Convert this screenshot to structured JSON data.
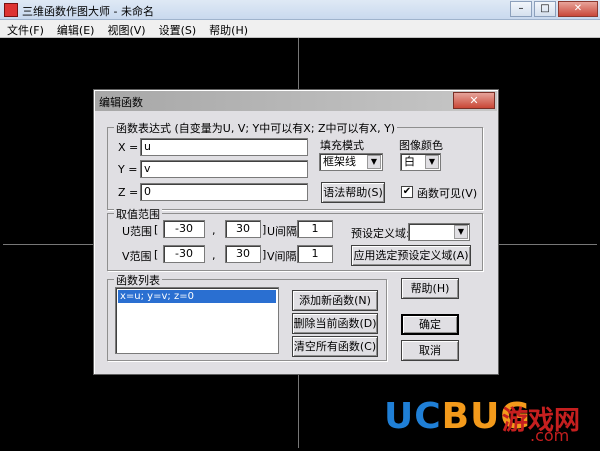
{
  "window": {
    "title": "三维函数作图大师 - 未命名",
    "min": "–",
    "max": "□",
    "close": "✕"
  },
  "menu": [
    "文件(F)",
    "编辑(E)",
    "视图(V)",
    "设置(S)",
    "帮助(H)"
  ],
  "dialog": {
    "title": "编辑函数",
    "close": "✕",
    "expr_group": {
      "title": "函数表达式 (自变量为U, V; Y中可以有X; Z中可以有X, Y)",
      "x_label": "X =",
      "x_value": "u",
      "y_label": "Y =",
      "y_value": "v",
      "z_label": "Z =",
      "z_value": "0",
      "fill_label": "填充模式",
      "fill_value": "框架线",
      "color_label": "图像颜色",
      "color_value": "白",
      "syntax_help": "语法帮助(S)",
      "visible_label": "函数可见(V)",
      "visible_checked": true
    },
    "range_group": {
      "title": "取值范围",
      "u_label": "U范围",
      "u_min": "-30",
      "u_max": "30",
      "u_step_label": "U间隔",
      "u_step": "1",
      "v_label": "V范围",
      "v_min": "-30",
      "v_max": "30",
      "v_step_label": "V间隔",
      "v_step": "1",
      "bracket_open": "[",
      "bracket_close": "]",
      "comma": ",",
      "preset_label": "预设定义域:",
      "preset_value": "",
      "apply_preset": "应用选定预设定义域(A)"
    },
    "list_group": {
      "title": "函数列表",
      "items": [
        "x=u; y=v; z=0"
      ],
      "add": "添加新函数(N)",
      "delete": "删除当前函数(D)",
      "clear": "清空所有函数(C)"
    },
    "help": "帮助(H)",
    "ok": "确定",
    "cancel": "取消"
  },
  "watermark": {
    "logo_u": "UC",
    "logo_b": "BUG",
    "cn": "游戏网",
    "com": ".com"
  },
  "colors": {
    "accent": "#2a6fd1",
    "logo_blue": "#1f7fd6",
    "logo_orange": "#f39a1b",
    "logo_red": "#c51f1f"
  }
}
